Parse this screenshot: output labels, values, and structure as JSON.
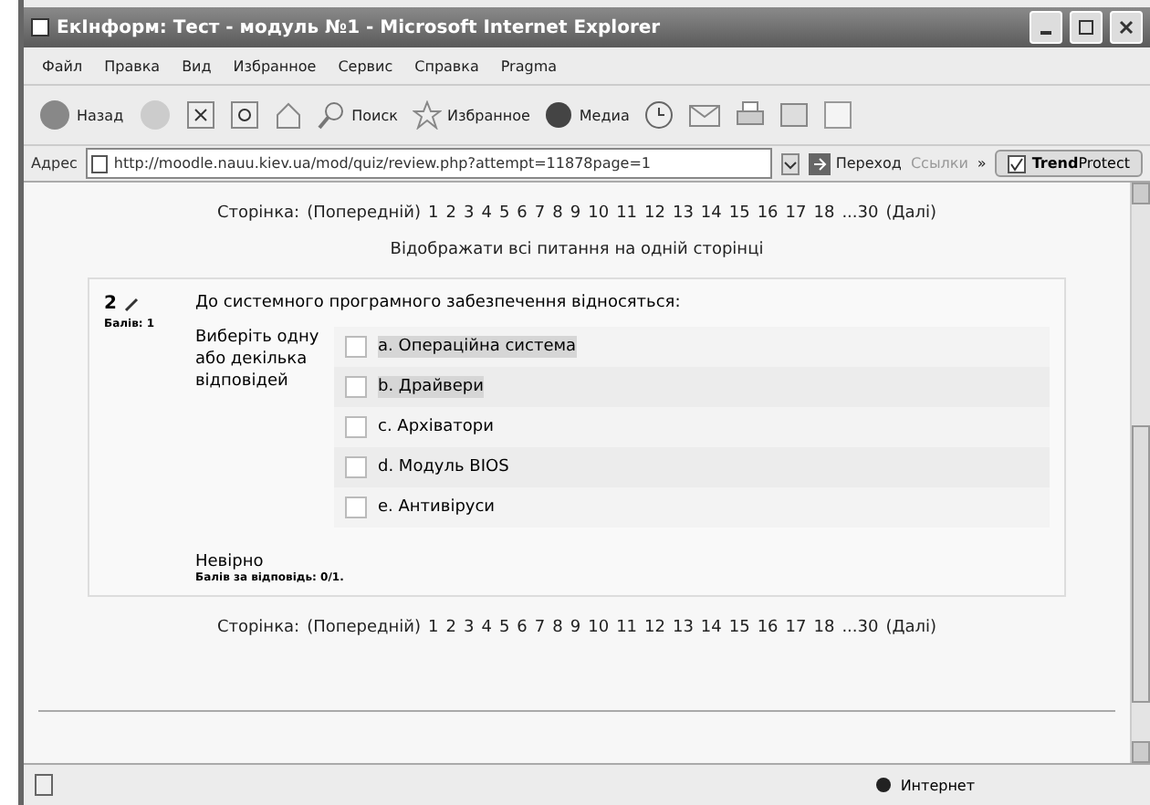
{
  "window": {
    "title": "ЕкІнформ: Тест - модуль №1 - Microsoft Internet Explorer"
  },
  "menu": [
    "Файл",
    "Правка",
    "Вид",
    "Избранное",
    "Сервис",
    "Справка",
    "Pragma"
  ],
  "toolbar": {
    "back": "Назад",
    "search": "Поиск",
    "favorites": "Избранное",
    "media": "Медиа"
  },
  "address_bar": {
    "label": "Адрес",
    "url": "http://moodle.nauu.kiev.ua/mod/quiz/review.php?attempt=11878page=1",
    "go": "Переход",
    "links": "Ссылки",
    "more": "»",
    "plugin": "**Trend**Protect"
  },
  "pager_top": {
    "label": "Сторінка:",
    "links": [
      "(Попередній)",
      "1",
      "2",
      "3",
      "4",
      "5",
      "6",
      "7",
      "8",
      "9",
      "10",
      "11",
      "12",
      "13",
      "14",
      "15",
      "16",
      "17",
      "18",
      "...30",
      "(Далі)"
    ]
  },
  "show_all_link": "Відображати всі питання на одній сторінці",
  "question": {
    "number": "2",
    "points": "Балів: 1",
    "text": "До системного програмного забезпечення відносяться:",
    "prompt": "Виберіть одну або декілька відповідей",
    "options": [
      {
        "label": "a. Операційна система",
        "checked": false,
        "highlighted": true
      },
      {
        "label": "b. Драйвери",
        "checked": false,
        "highlighted": true
      },
      {
        "label": "c. Архіватори",
        "checked": false,
        "highlighted": false
      },
      {
        "label": "d. Модуль BIOS",
        "checked": false,
        "highlighted": false
      },
      {
        "label": "e. Антивіруси",
        "checked": false,
        "highlighted": false
      }
    ],
    "result": "Невірно",
    "score": "Балів за відповідь: 0/1."
  },
  "pager_bottom": {
    "label": "Сторінка:",
    "links": [
      "(Попередній)",
      "1",
      "2",
      "3",
      "4",
      "5",
      "6",
      "7",
      "8",
      "9",
      "10",
      "11",
      "12",
      "13",
      "14",
      "15",
      "16",
      "17",
      "18",
      "...30",
      "(Далі)"
    ]
  },
  "status_bar": {
    "zone": "Интернет"
  }
}
